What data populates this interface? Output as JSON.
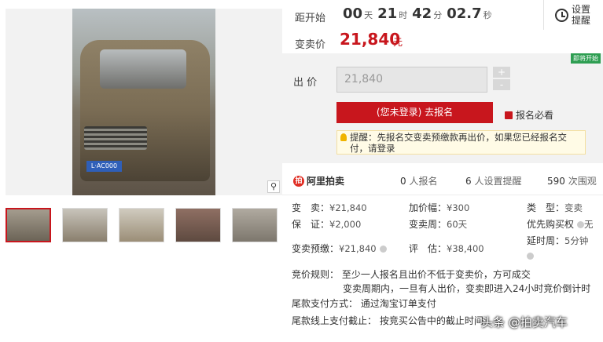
{
  "countdown": {
    "label": "距开始",
    "days": "00",
    "days_unit": "天",
    "hours": "21",
    "hours_unit": "时",
    "minutes": "42",
    "minutes_unit": "分",
    "seconds": "02.7",
    "seconds_unit": "秒"
  },
  "reminder_button": "设置提醒",
  "price": {
    "label": "变卖价",
    "value": "21,840",
    "unit": "元"
  },
  "bid": {
    "soon_tag": "即将开始",
    "label": "出 价",
    "input_value": "21,840",
    "plus": "+",
    "minus": "-",
    "register_button": "(您未登录) 去报名",
    "must_read": "报名必看",
    "tip": "提醒：先报名交变卖预缴款再出价，如果您已经报名交付，请登录"
  },
  "photo": {
    "plate_text": "L·AC000"
  },
  "stats": {
    "platform": "阿里拍卖",
    "signups_count": "0",
    "signups_label": "人报名",
    "reminders_count": "6",
    "reminders_label": "人设置提醒",
    "views_count": "590",
    "views_label": "次围观"
  },
  "details": {
    "sale_label": "变　卖：",
    "sale_value": "¥21,840",
    "increment_label": "加价幅：",
    "increment_value": "¥300",
    "type_label": "类　型：",
    "type_value": "变卖",
    "deposit_label": "保　证：",
    "deposit_value": "¥2,000",
    "period_label": "变卖周：",
    "period_value": "60天",
    "priority_label": "优先购买权",
    "priority_value": "无",
    "prepay_label": "变卖预缴：",
    "prepay_value": "¥21,840",
    "appraisal_label": "评　估：",
    "appraisal_value": "¥38,400",
    "delay_label": "延时周：",
    "delay_value": "5分钟"
  },
  "rules": {
    "line1": "竞价规则：  至少一人报名且出价不低于变卖价，方可成交",
    "line2": "变卖周期内，一旦有人出价，变卖即进入24小时竞价倒计时",
    "line3": "尾款支付方式：  通过淘宝订单支付",
    "line4": "尾款线上支付截止：  按竞买公告中的截止时间"
  },
  "watermark": "头条 @拍卖汽车",
  "colors": {
    "accent": "#c8161d",
    "tag_green": "#2e9e52"
  }
}
